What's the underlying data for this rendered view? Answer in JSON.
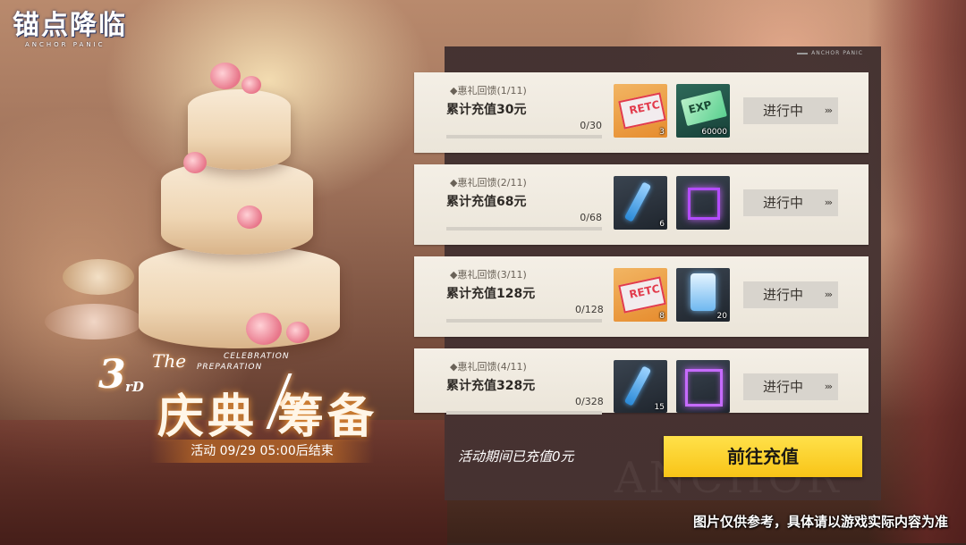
{
  "logo": {
    "title": "锚点降临",
    "subtitle": "ANCHOR PANIC"
  },
  "banner": {
    "edition_number": "3",
    "edition_suffix": "rD",
    "the": "The",
    "celebration_line1": "CELEBRATION",
    "celebration_line2": "PREPARATION",
    "title_left": "庆典",
    "title_right": "筹备",
    "end_time": "活动 09/29 05:00后结束"
  },
  "panel": {
    "tag": "ANCHOR PANIC",
    "watermark": "ANCHOR",
    "rewards": [
      {
        "tag": "◆惠礼回馈(1/11)",
        "title": "累计充值30元",
        "progress_text": "0/30",
        "progress": 0,
        "items": [
          {
            "icon": "ticket-icon",
            "label": "RETC",
            "count": "3",
            "rarity": "orange"
          },
          {
            "icon": "exp-card-icon",
            "label": "EXP",
            "count": "60000",
            "rarity": "green"
          }
        ],
        "status": "进行中"
      },
      {
        "tag": "◆惠礼回馈(2/11)",
        "title": "累计充值68元",
        "progress_text": "0/68",
        "progress": 0,
        "items": [
          {
            "icon": "vial-icon",
            "label": "",
            "count": "6",
            "rarity": "dark"
          },
          {
            "icon": "avatar-frame-icon",
            "label": "",
            "count": "",
            "rarity": "dark"
          }
        ],
        "status": "进行中"
      },
      {
        "tag": "◆惠礼回馈(3/11)",
        "title": "累计充值128元",
        "progress_text": "0/128",
        "progress": 0,
        "items": [
          {
            "icon": "ticket-icon",
            "label": "RETC",
            "count": "8",
            "rarity": "orange"
          },
          {
            "icon": "crystal-icon",
            "label": "",
            "count": "20",
            "rarity": "dark"
          }
        ],
        "status": "进行中"
      },
      {
        "tag": "◆惠礼回馈(4/11)",
        "title": "累计充值328元",
        "progress_text": "0/328",
        "progress": 0,
        "items": [
          {
            "icon": "vial-icon",
            "label": "",
            "count": "15",
            "rarity": "dark"
          },
          {
            "icon": "avatar-frame-icon",
            "label": "",
            "count": "",
            "rarity": "dark"
          }
        ],
        "status": "进行中"
      }
    ],
    "paid_text": "活动期间已充值0元",
    "recharge_button": "前往充值"
  },
  "disclaimer": "图片仅供参考，具体请以游戏实际内容为准",
  "colors": {
    "accent_yellow": "#f8c417",
    "card_bg": "#f4efe6",
    "panel_bg": "#3e2e2e",
    "progress_fill": "#e8a24a"
  }
}
